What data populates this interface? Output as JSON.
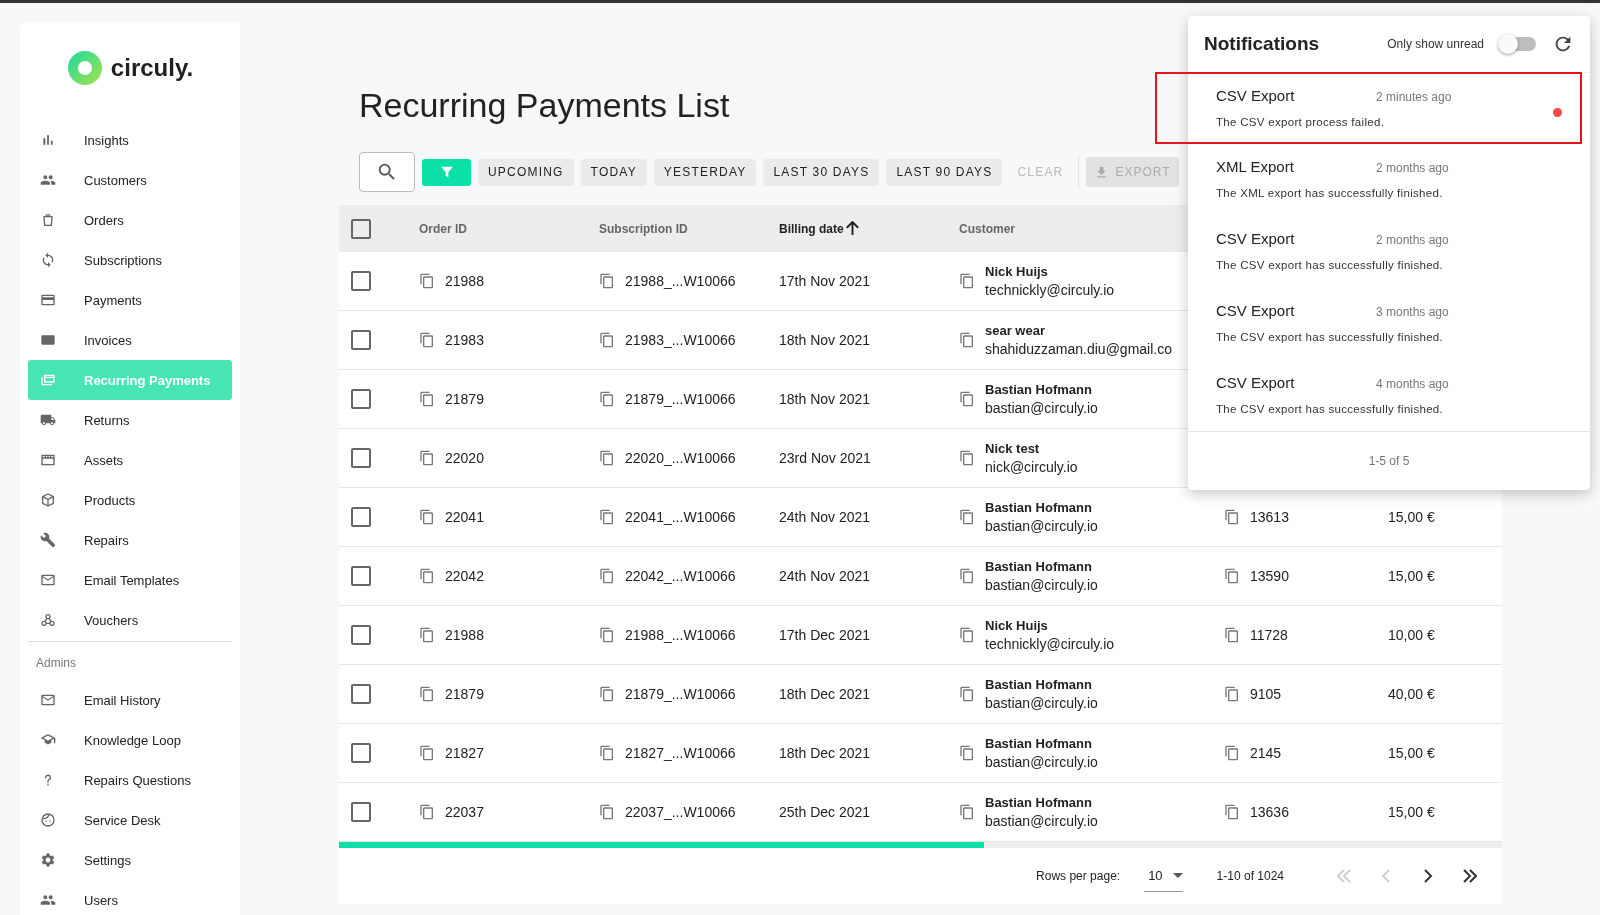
{
  "sidebar": {
    "logo": "circuly.",
    "items": [
      {
        "label": "Insights",
        "selected": false
      },
      {
        "label": "Customers",
        "selected": false
      },
      {
        "label": "Orders",
        "selected": false
      },
      {
        "label": "Subscriptions",
        "selected": false
      },
      {
        "label": "Payments",
        "selected": false
      },
      {
        "label": "Invoices",
        "selected": false
      },
      {
        "label": "Recurring Payments",
        "selected": true
      },
      {
        "label": "Returns",
        "selected": false
      },
      {
        "label": "Assets",
        "selected": false
      },
      {
        "label": "Products",
        "selected": false
      },
      {
        "label": "Repairs",
        "selected": false
      },
      {
        "label": "Email Templates",
        "selected": false
      },
      {
        "label": "Vouchers",
        "selected": false
      }
    ],
    "section_title": "Admins",
    "admin_items": [
      {
        "label": "Email History",
        "selected": false
      },
      {
        "label": "Knowledge Loop",
        "selected": false
      },
      {
        "label": "Repairs Questions",
        "selected": false
      },
      {
        "label": "Service Desk",
        "selected": false
      },
      {
        "label": "Settings",
        "selected": false
      },
      {
        "label": "Users",
        "selected": false
      }
    ]
  },
  "page_title": "Recurring Payments List",
  "toolbar": {
    "filters": [
      {
        "label": "UPCOMING",
        "selected": false
      },
      {
        "label": "TODAY",
        "selected": false
      },
      {
        "label": "YESTERDAY",
        "selected": false
      },
      {
        "label": "LAST 30 DAYS",
        "selected": false
      },
      {
        "label": "LAST 90 DAYS",
        "selected": false
      }
    ],
    "clear": {
      "label": "CLEAR",
      "disabled": true
    },
    "export": {
      "label": "EXPORT",
      "disabled": true
    }
  },
  "table": {
    "header_checked": false,
    "columns": [
      {
        "label": "Order ID",
        "sorted": false
      },
      {
        "label": "Subscription ID",
        "sorted": false
      },
      {
        "label": "Billing date",
        "sorted": true
      },
      {
        "label": "Customer",
        "sorted": false
      }
    ],
    "rows": [
      {
        "checked": false,
        "order_id": "21988",
        "subscription_id": "21988_...W10066",
        "billing_date": "17th Nov 2021",
        "customer_name": "Nick Huijs",
        "customer_email": "technickly@circuly.io"
      },
      {
        "checked": false,
        "order_id": "21983",
        "subscription_id": "21983_...W10066",
        "billing_date": "18th Nov 2021",
        "customer_name": "sear wear",
        "customer_email": "shahiduzzaman.diu@gmail.co"
      },
      {
        "checked": false,
        "order_id": "21879",
        "subscription_id": "21879_...W10066",
        "billing_date": "18th Nov 2021",
        "customer_name": "Bastian Hofmann",
        "customer_email": "bastian@circuly.io"
      },
      {
        "checked": false,
        "order_id": "22020",
        "subscription_id": "22020_...W10066",
        "billing_date": "23rd Nov 2021",
        "customer_name": "Nick test",
        "customer_email": "nick@circuly.io"
      },
      {
        "checked": false,
        "order_id": "22041",
        "subscription_id": "22041_...W10066",
        "billing_date": "24th Nov 2021",
        "customer_name": "Bastian Hofmann",
        "customer_email": "bastian@circuly.io",
        "column_5": "13613",
        "column_6": "15,00 €"
      },
      {
        "checked": false,
        "order_id": "22042",
        "subscription_id": "22042_...W10066",
        "billing_date": "24th Nov 2021",
        "customer_name": "Bastian Hofmann",
        "customer_email": "bastian@circuly.io",
        "column_5": "13590",
        "column_6": "15,00 €"
      },
      {
        "checked": false,
        "order_id": "21988",
        "subscription_id": "21988_...W10066",
        "billing_date": "17th Dec 2021",
        "customer_name": "Nick Huijs",
        "customer_email": "technickly@circuly.io",
        "column_5": "11728",
        "column_6": "10,00 €"
      },
      {
        "checked": false,
        "order_id": "21879",
        "subscription_id": "21879_...W10066",
        "billing_date": "18th Dec 2021",
        "customer_name": "Bastian Hofmann",
        "customer_email": "bastian@circuly.io",
        "column_5": "9105",
        "column_6": "40,00 €"
      },
      {
        "checked": false,
        "order_id": "21827",
        "subscription_id": "21827_...W10066",
        "billing_date": "18th Dec 2021",
        "customer_name": "Bastian Hofmann",
        "customer_email": "bastian@circuly.io",
        "column_5": "2145",
        "column_6": "15,00 €"
      },
      {
        "checked": false,
        "order_id": "22037",
        "subscription_id": "22037_...W10066",
        "billing_date": "25th Dec 2021",
        "customer_name": "Bastian Hofmann",
        "customer_email": "bastian@circuly.io",
        "column_5": "13636",
        "column_6": "15,00 €"
      }
    ]
  },
  "pagination": {
    "rows_per_page_label": "Rows per page:",
    "rows_per_page": "10",
    "range": "1-10 of 1024",
    "buttons": [
      {
        "kind": "first",
        "disabled": true
      },
      {
        "kind": "prev",
        "disabled": true
      },
      {
        "kind": "next",
        "disabled": false
      },
      {
        "kind": "last",
        "disabled": false
      }
    ]
  },
  "notifications": {
    "title": "Notifications",
    "unread_toggle": {
      "label": "Only show unread",
      "on": false
    },
    "items": [
      {
        "title": "CSV Export",
        "time": "2 minutes ago",
        "message": "The CSV export process failed.",
        "unread": true,
        "highlighted": true
      },
      {
        "title": "XML Export",
        "time": "2 months ago",
        "message": "The XML export has successfully finished.",
        "unread": false,
        "highlighted": false
      },
      {
        "title": "CSV Export",
        "time": "2 months ago",
        "message": "The CSV export has successfully finished.",
        "unread": false,
        "highlighted": false
      },
      {
        "title": "CSV Export",
        "time": "3 months ago",
        "message": "The CSV export has successfully finished.",
        "unread": false,
        "highlighted": false
      },
      {
        "title": "CSV Export",
        "time": "4 months ago",
        "message": "The CSV export has successfully finished.",
        "unread": false,
        "highlighted": false
      }
    ],
    "footer": "1-5 of 5"
  }
}
